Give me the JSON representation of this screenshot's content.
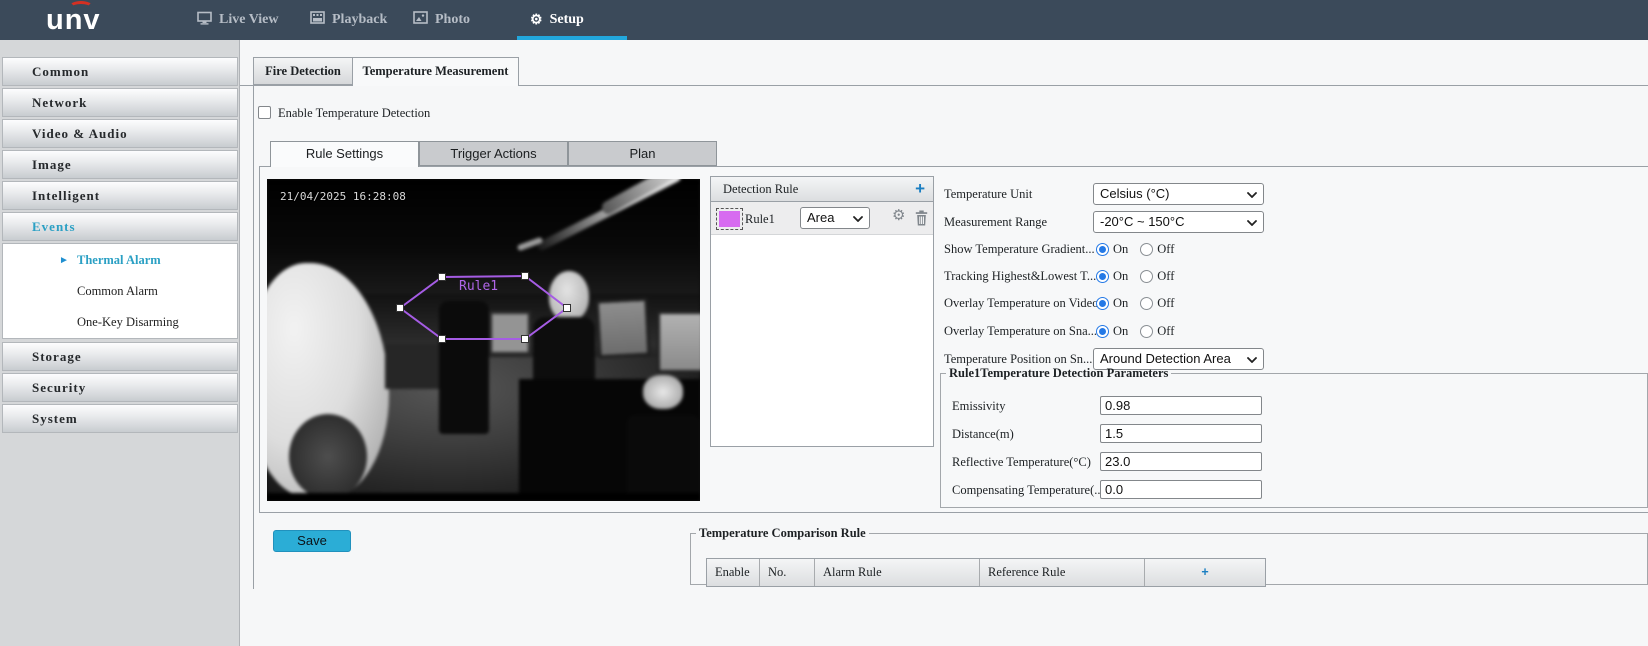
{
  "icons": {
    "plus": "+",
    "gear": "⚙",
    "submenu_arrow": "►"
  },
  "navbar": {
    "logo_text": "unv",
    "items": [
      {
        "label": "Live View"
      },
      {
        "label": "Playback"
      },
      {
        "label": "Photo"
      },
      {
        "label": "Setup"
      }
    ],
    "colors": {
      "background": "#3b4a5a",
      "active_underline": "#22a7dc",
      "logo_red": "#d43023"
    }
  },
  "sidebar": {
    "items": [
      {
        "label": "Common"
      },
      {
        "label": "Network"
      },
      {
        "label": "Video & Audio"
      },
      {
        "label": "Image"
      },
      {
        "label": "Intelligent"
      },
      {
        "label": "Events"
      },
      {
        "label": "Storage"
      },
      {
        "label": "Security"
      },
      {
        "label": "System"
      }
    ],
    "events_submenu": [
      {
        "label": "Thermal Alarm",
        "selected": true
      },
      {
        "label": "Common Alarm",
        "selected": false
      },
      {
        "label": "One-Key Disarming",
        "selected": false
      }
    ],
    "highlight_color": "#2ba0c4"
  },
  "page_tabs": [
    {
      "label": "Fire Detection",
      "active": false
    },
    {
      "label": "Temperature Measurement",
      "active": true
    }
  ],
  "enable_checkbox": {
    "label": "Enable Temperature Detection",
    "checked": false
  },
  "inner_tabs": [
    {
      "label": "Rule Settings",
      "active": true
    },
    {
      "label": "Trigger Actions",
      "active": false
    },
    {
      "label": "Plan",
      "active": false
    }
  ],
  "video": {
    "timestamp": "21/04/2025 16:28:08",
    "rule_label": "Rule1",
    "polygon_color": "#a55ce4"
  },
  "detection_rule": {
    "header": "Detection Rule",
    "rule": {
      "name": "Rule1",
      "type_value": "Area",
      "swatch_color": "#d76bf0"
    }
  },
  "settings": {
    "radio_on": "On",
    "radio_off": "Off",
    "radio_color": "#2479e6",
    "rows": [
      {
        "label": "Temperature Unit",
        "type": "select",
        "value": "Celsius (°C)"
      },
      {
        "label": "Measurement Range",
        "type": "select",
        "value": "-20°C ~ 150°C"
      },
      {
        "label": "Show Temperature Gradient...",
        "type": "radio",
        "value": "On"
      },
      {
        "label": "Tracking Highest&Lowest T...",
        "type": "radio",
        "value": "On"
      },
      {
        "label": "Overlay Temperature on Video",
        "type": "radio",
        "value": "On"
      },
      {
        "label": "Overlay Temperature on Sna...",
        "type": "radio",
        "value": "On"
      },
      {
        "label": "Temperature Position on Sn...",
        "type": "select",
        "value": "Around Detection Area"
      }
    ]
  },
  "rule_params": {
    "legend": "Rule1Temperature Detection Parameters",
    "fields": [
      {
        "label": "Emissivity",
        "value": "0.98"
      },
      {
        "label": "Distance(m)",
        "value": "1.5"
      },
      {
        "label": "Reflective Temperature(°C)",
        "value": "23.0"
      },
      {
        "label": "Compensating Temperature(...",
        "value": "0.0"
      }
    ]
  },
  "save_button": {
    "label": "Save",
    "color": "#2badd6"
  },
  "comparison_rule": {
    "legend": "Temperature Comparison Rule",
    "columns": [
      "Enable",
      "No.",
      "Alarm Rule",
      "Reference Rule"
    ],
    "rows": []
  }
}
